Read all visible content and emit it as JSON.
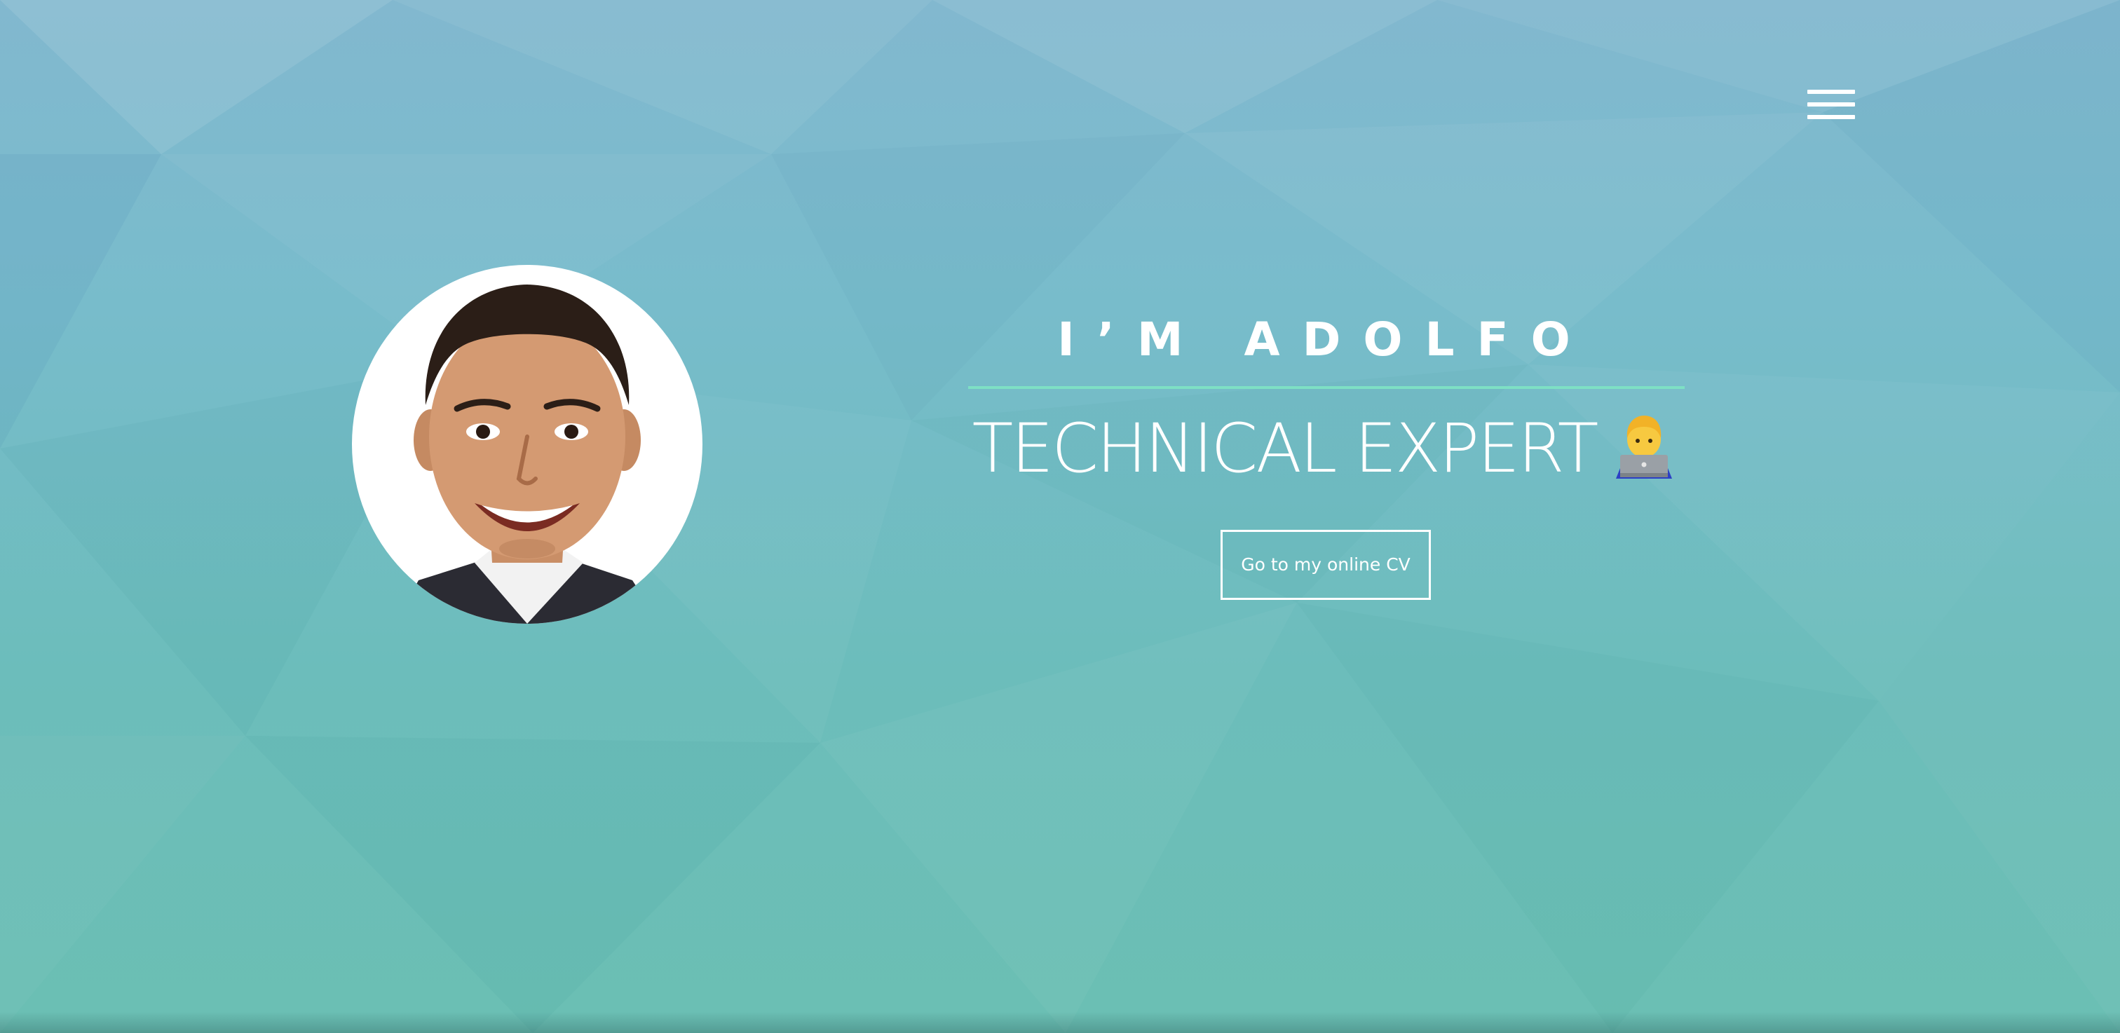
{
  "nav": {
    "menu_icon": "hamburger-menu-icon"
  },
  "hero": {
    "avatar_icon": "profile-photo",
    "greeting": "I’M ADOLFO",
    "role": "TECHNICAL EXPERT",
    "role_emoji": "technologist-emoji",
    "cta_label": "Go to my online CV"
  },
  "colors": {
    "background_top": "#82b8cf",
    "background_bottom": "#6bbfb3",
    "divider": "#7ee0c4",
    "text": "#ffffff"
  }
}
